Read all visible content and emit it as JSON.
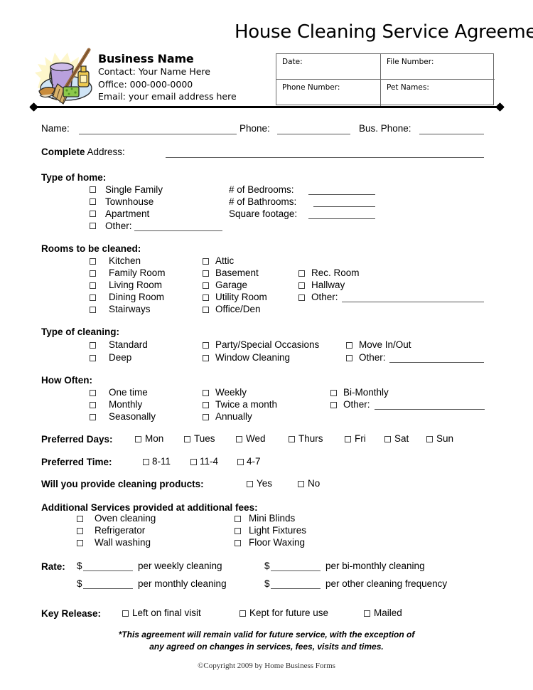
{
  "document": {
    "title": "House Cleaning Service Agreement",
    "copyright": "©Copyright 2009 by Home Business Forms",
    "footnote_line1": "*This agreement will remain valid for future service, with the exception of",
    "footnote_line2": "any agreed on changes in services, fees, visits and times."
  },
  "business": {
    "name": "Business Name",
    "contact": "Contact:  Your Name Here",
    "office": "Office:  000-000-0000",
    "email": "Email:  your email address here",
    "logo_icon": "cleaning-supplies-clipart"
  },
  "header_table": {
    "date_label": "Date:",
    "file_number_label": "File Number:",
    "phone_number_label": "Phone Number:",
    "pet_names_label": "Pet Names:",
    "date_value": "",
    "file_number_value": "",
    "phone_number_value": "",
    "pet_names_value": ""
  },
  "contact_row": {
    "name_label": "Name:",
    "name_value": "",
    "phone_label": "Phone:",
    "phone_value": "",
    "bus_phone_label": "Bus. Phone:",
    "bus_phone_value": "",
    "address_label_bold": "Complete",
    "address_label_rest": " Address:",
    "address_value": ""
  },
  "type_of_home": {
    "heading": "Type of home:",
    "options": [
      "Single Family",
      "Townhouse",
      "Apartment",
      "Other:"
    ],
    "fields": [
      {
        "label": "# of Bedrooms:",
        "value": ""
      },
      {
        "label": "# of Bathrooms:",
        "value": ""
      },
      {
        "label": "Square footage:",
        "value": ""
      }
    ]
  },
  "rooms": {
    "heading": "Rooms to be cleaned:",
    "col1": [
      "Kitchen",
      "Family Room",
      "Living Room",
      "Dining Room",
      "Stairways"
    ],
    "col2": [
      "Attic",
      "Basement",
      "Garage",
      "Utility Room",
      "Office/Den"
    ],
    "col3": [
      "Rec. Room",
      "Hallway",
      "Other:"
    ]
  },
  "type_of_cleaning": {
    "heading": "Type of cleaning:",
    "col1": [
      "Standard",
      "Deep"
    ],
    "col2": [
      "Party/Special Occasions",
      "Window Cleaning"
    ],
    "col3": [
      "Move In/Out",
      "Other:"
    ]
  },
  "how_often": {
    "heading": "How Often:",
    "col1": [
      "One time",
      "Monthly",
      "Seasonally"
    ],
    "col2": [
      "Weekly",
      "Twice a month",
      "Annually"
    ],
    "col3": [
      "Bi-Monthly",
      "Other:"
    ]
  },
  "preferred_days": {
    "label": "Preferred Days:",
    "options": [
      "Mon",
      "Tues",
      "Wed",
      "Thurs",
      "Fri",
      "Sat",
      "Sun"
    ]
  },
  "preferred_time": {
    "label": "Preferred Time:",
    "options": [
      "8-11",
      "11-4",
      "4-7"
    ]
  },
  "cleaning_products": {
    "label": "Will you provide cleaning products:",
    "options": [
      "Yes",
      "No"
    ]
  },
  "additional_services": {
    "heading": "Additional Services provided at additional fees:",
    "col1": [
      "Oven cleaning",
      "Refrigerator",
      "Wall washing"
    ],
    "col2": [
      "Mini Blinds",
      "Light Fixtures",
      "Floor Waxing"
    ]
  },
  "rate": {
    "label": "Rate:",
    "currency": "$",
    "entries": [
      {
        "suffix": "per weekly cleaning",
        "value": ""
      },
      {
        "suffix": "per bi-monthly cleaning",
        "value": ""
      },
      {
        "suffix": "per monthly cleaning",
        "value": ""
      },
      {
        "suffix": "per other cleaning frequency",
        "value": ""
      }
    ]
  },
  "key_release": {
    "label": "Key Release:",
    "options": [
      "Left on final visit",
      "Kept for future use",
      "Mailed"
    ]
  },
  "colors": {
    "text": "#000000",
    "rule": "#555555",
    "table_border": "#6b6b6b",
    "logo_bucket": "#a98fd0",
    "logo_bottle": "#e8c84a",
    "logo_sponge": "#7bc043",
    "logo_broom": "#9b6b3e"
  }
}
